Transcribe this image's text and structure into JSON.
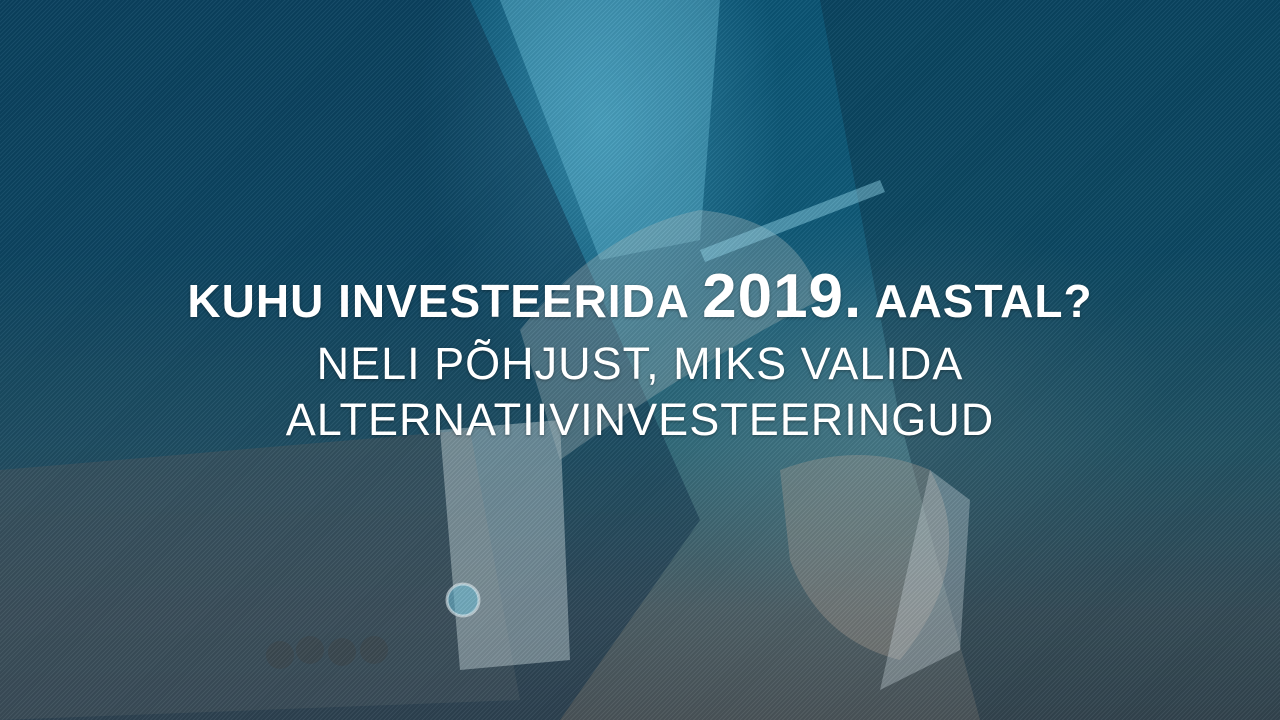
{
  "headline": {
    "part1": "KUHU INVESTEERIDA",
    "year": "2019.",
    "part2": "AASTAL?"
  },
  "subtitle": {
    "line1": "NELI PÕHJUST, MIKS VALIDA",
    "line2": "ALTERNATIIVINVESTEERINGUD"
  },
  "colors": {
    "overlay_top": "#0b5575",
    "overlay_bottom": "#4a5459",
    "text": "#ffffff"
  },
  "background_image": "businessman-adjusting-cufflink-photo"
}
